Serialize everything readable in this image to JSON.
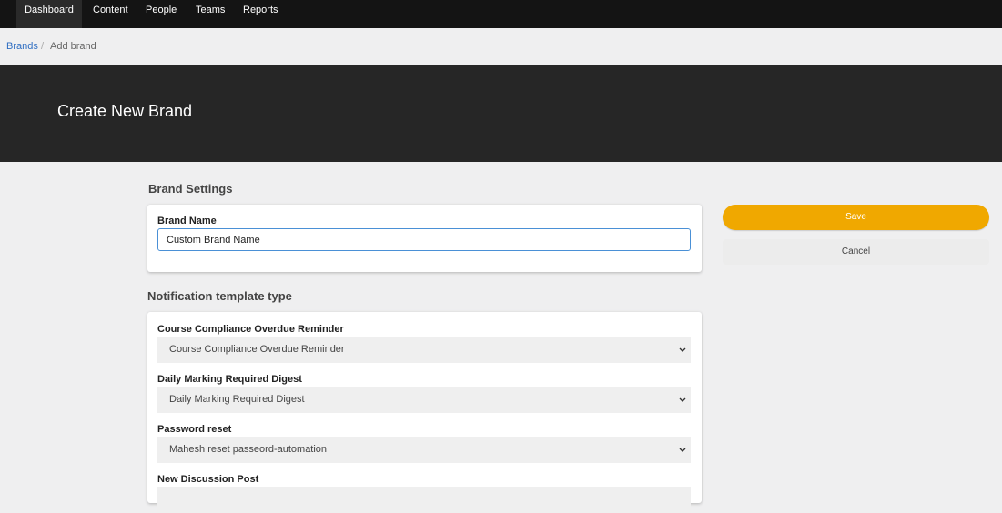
{
  "nav": {
    "items": [
      {
        "label": "Dashboard",
        "active": true
      },
      {
        "label": "Content"
      },
      {
        "label": "People"
      },
      {
        "label": "Teams"
      },
      {
        "label": "Reports"
      }
    ]
  },
  "breadcrumb": {
    "parent": "Brands",
    "separator": "/",
    "current": "Add brand"
  },
  "hero": {
    "title": "Create New Brand"
  },
  "brand_settings": {
    "heading": "Brand Settings",
    "name_label": "Brand Name",
    "name_value": "Custom Brand Name"
  },
  "notifications": {
    "heading": "Notification template type",
    "fields": [
      {
        "label": "Course Compliance Overdue Reminder",
        "value": "Course Compliance Overdue Reminder"
      },
      {
        "label": "Daily Marking Required Digest",
        "value": "Daily Marking Required Digest"
      },
      {
        "label": "Password reset",
        "value": "Mahesh reset passeord-automation"
      },
      {
        "label": "New Discussion Post",
        "value": ""
      }
    ]
  },
  "actions": {
    "save_label": "Save",
    "cancel_label": "Cancel"
  },
  "colors": {
    "accent": "#f0a800",
    "link": "#2f6ec2",
    "nav_bg": "#141414",
    "hero_bg": "#262626",
    "focus_border": "#4a90d6"
  }
}
